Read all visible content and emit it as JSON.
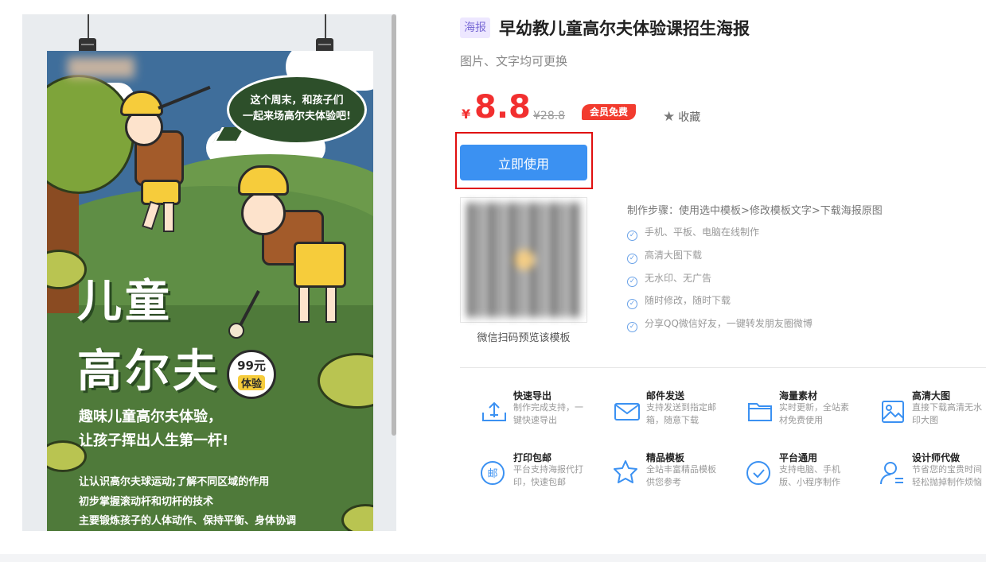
{
  "poster": {
    "speech_bubble_line1": "这个周末，和孩子们",
    "speech_bubble_line2": "一起来场高尔夫体验吧!",
    "title_line1": "儿童",
    "title_line2": "高尔夫",
    "price_tag_top": "99元",
    "price_tag_bottom": "体验",
    "slogan_line1": "趣味儿童高尔夫体验，",
    "slogan_line2": "让孩子挥出人生第一杆!",
    "bullets": [
      "让认识高尔夫球运动;了解不同区域的作用",
      "初步掌握滚动杆和切杆的技术",
      "主要锻炼孩子的人体动作、保持平衡、身体协调"
    ]
  },
  "product": {
    "tag": "海报",
    "title": "早幼教儿童高尔夫体验课招生海报",
    "subtitle": "图片、文字均可更换",
    "currency": "¥",
    "price": "8.8",
    "original_price": "¥28.8",
    "vip_badge": "会员免费",
    "favorite_label": "收藏",
    "use_button": "立即使用",
    "qr_caption": "微信扫码预览该模板",
    "steps_title": "制作步骤：使用选中模板>修改模板文字>下载海报原图",
    "features": [
      "手机、平板、电脑在线制作",
      "高清大图下载",
      "无水印、无广告",
      "随时修改，随时下载",
      "分享QQ微信好友，一键转发朋友圈微博"
    ]
  },
  "services": [
    {
      "title": "快速导出",
      "desc": "制作完成支持，一键快速导出",
      "icon": "export-icon"
    },
    {
      "title": "邮件发送",
      "desc": "支持发送到指定邮箱，随意下载",
      "icon": "mail-icon"
    },
    {
      "title": "海量素材",
      "desc": "实时更新，全站素材免费使用",
      "icon": "folder-icon"
    },
    {
      "title": "高清大图",
      "desc": "直接下载高清无水印大图",
      "icon": "image-icon"
    },
    {
      "title": "打印包邮",
      "desc": "平台支持海报代打印，快速包邮",
      "icon": "post-icon"
    },
    {
      "title": "精品模板",
      "desc": "全站丰富精品模板供您参考",
      "icon": "star-icon"
    },
    {
      "title": "平台通用",
      "desc": "支持电脑、手机版、小程序制作",
      "icon": "check-circle-icon"
    },
    {
      "title": "设计师代做",
      "desc": "节省您的宝贵时间轻松抛掉制作烦恼",
      "icon": "designer-icon"
    }
  ],
  "colors": {
    "accent": "#3b91f2",
    "price_red": "#f22f2f",
    "poster_green": "#4f7a3a"
  },
  "icon_glyphs": {
    "post_char": "邮"
  }
}
